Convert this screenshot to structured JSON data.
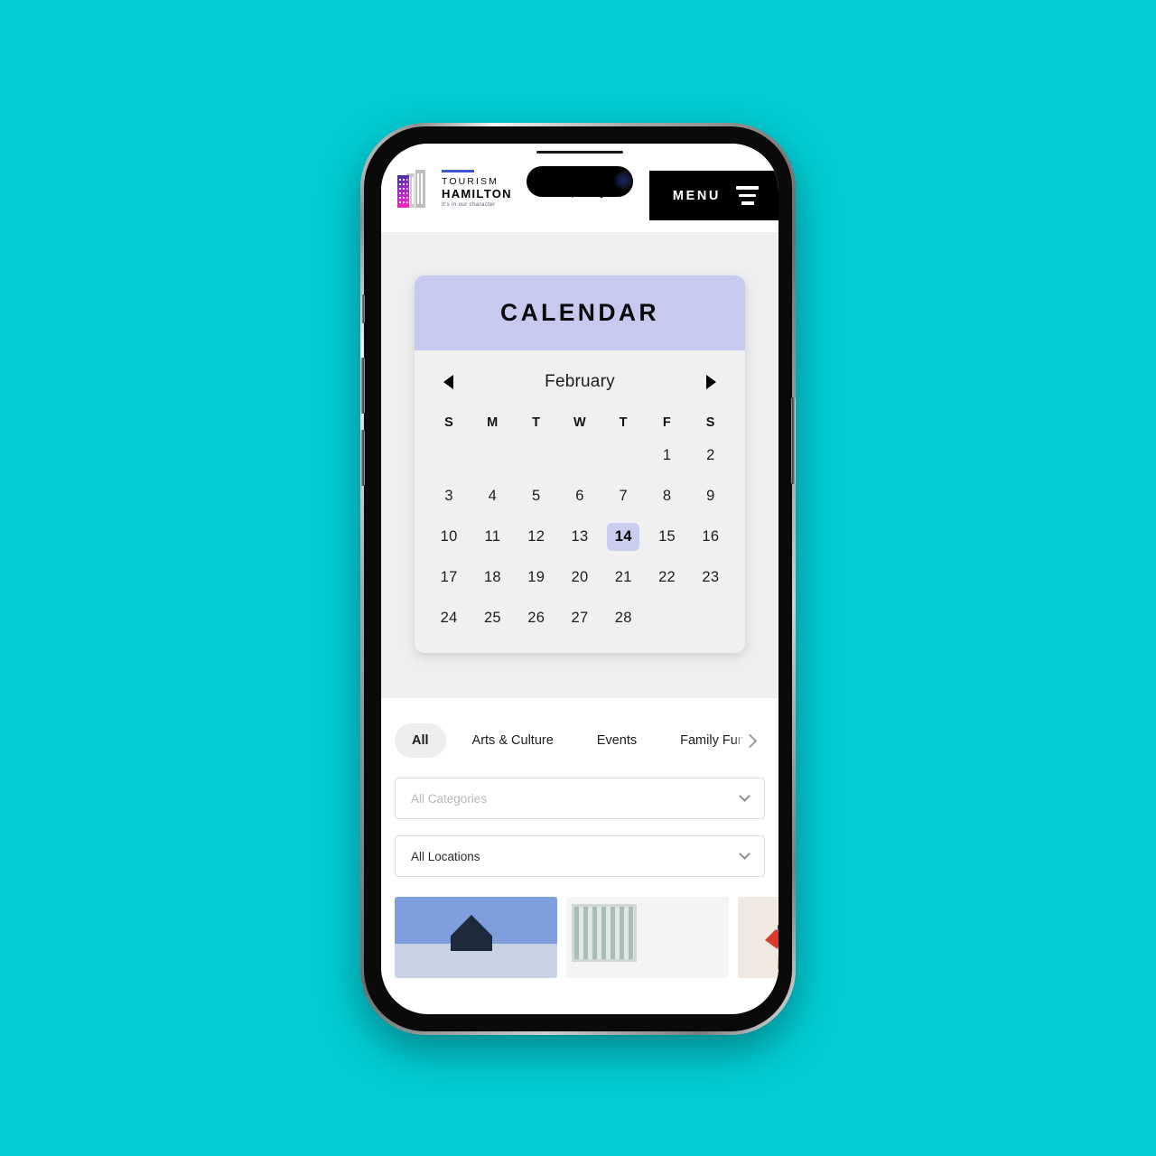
{
  "page": {
    "background_color": "#00cdd4"
  },
  "header": {
    "logo": {
      "rule_color": "#3a57c9",
      "line1": "TOURISM",
      "line2": "HAMILTON",
      "tagline": "It's in our character",
      "mark_gradient_start": "#3c2f8f",
      "mark_gradient_end": "#f02ab8",
      "mark_gray": "#bdbdbd"
    },
    "search_icon": "search-icon",
    "location_icon": "map-pin-icon",
    "menu_label": "MENU",
    "menu_icon": "hamburger-icon",
    "menu_background": "#000000"
  },
  "calendar": {
    "title": "CALENDAR",
    "title_bar_color": "#c7caee",
    "section_background": "#efefef",
    "prev_icon": "triangle-left-icon",
    "next_icon": "triangle-right-icon",
    "month": "February",
    "weekdays": [
      "S",
      "M",
      "T",
      "W",
      "T",
      "F",
      "S"
    ],
    "selected_day": 14,
    "selected_day_color": "#c9cdf0",
    "weeks": [
      [
        "",
        "",
        "",
        "",
        "",
        "1",
        "2"
      ],
      [
        "3",
        "4",
        "5",
        "6",
        "7",
        "8",
        "9"
      ],
      [
        "10",
        "11",
        "12",
        "13",
        "14",
        "15",
        "16"
      ],
      [
        "17",
        "18",
        "19",
        "20",
        "21",
        "22",
        "23"
      ],
      [
        "24",
        "25",
        "26",
        "27",
        "28",
        "",
        ""
      ]
    ]
  },
  "filters": {
    "tabs": [
      {
        "label": "All",
        "active": true
      },
      {
        "label": "Arts & Culture",
        "active": false
      },
      {
        "label": "Events",
        "active": false
      },
      {
        "label": "Family Fun",
        "active": false
      }
    ],
    "scroll_next_icon": "chevron-right-icon",
    "category_select": {
      "value": "All Categories",
      "is_placeholder": true,
      "chevron_icon": "chevron-down-icon"
    },
    "location_select": {
      "value": "All Locations",
      "is_placeholder": false,
      "chevron_icon": "chevron-down-icon"
    }
  },
  "event_strip": {
    "thumbs": [
      "event-photo-glass-building",
      "event-photo-striped-wall",
      "event-photo-person-red"
    ]
  }
}
